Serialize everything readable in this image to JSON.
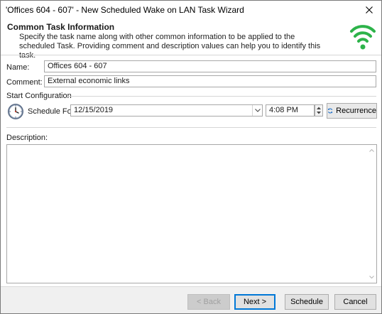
{
  "window": {
    "title": "'Offices 604 - 607' - New Scheduled Wake on LAN Task Wizard"
  },
  "header": {
    "title": "Common Task Information",
    "description": "Specify the task name along with other common information to be applied to the scheduled Task. Providing comment and description values can help you to identify this task.",
    "icon": "wifi-icon",
    "icon_color": "#2db34a"
  },
  "form": {
    "name_label": "Name:",
    "name_value": "Offices 604 - 607",
    "comment_label": "Comment:",
    "comment_value": "External economic links",
    "start_section": "Start Configuration",
    "schedule_label": "Schedule For:",
    "schedule_date": "12/15/2019",
    "schedule_time": "4:08 PM",
    "recurrence_label": "Recurrence",
    "description_label": "Description:",
    "description_value": ""
  },
  "footer": {
    "back_label": "< Back",
    "next_label": "Next >",
    "schedule_label": "Schedule",
    "cancel_label": "Cancel"
  },
  "colors": {
    "accent": "#0078d7",
    "recurrence_icon": "#1e6fc8"
  }
}
